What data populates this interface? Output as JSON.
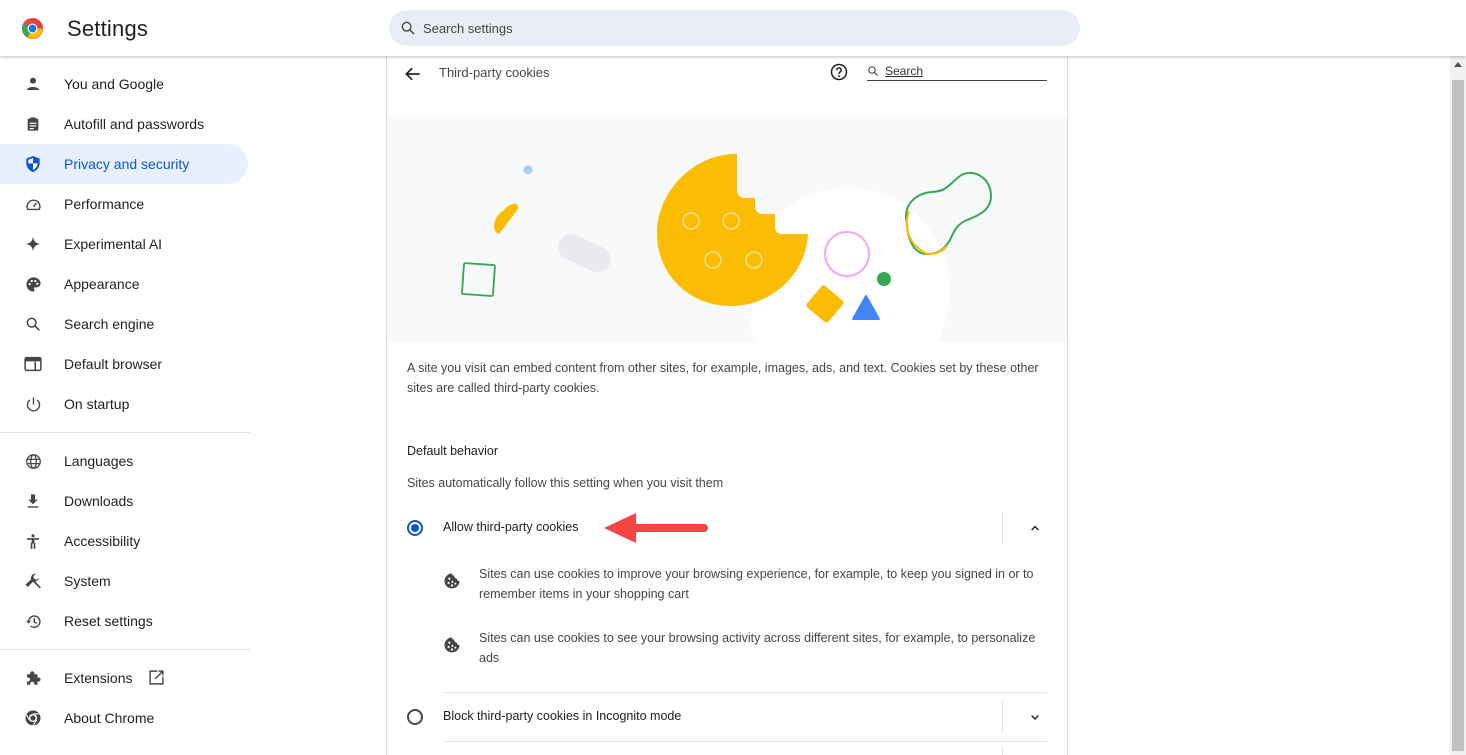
{
  "app": {
    "title": "Settings",
    "search_placeholder": "Search settings"
  },
  "sidebar": {
    "items": [
      {
        "label": "You and Google",
        "icon": "person-icon"
      },
      {
        "label": "Autofill and passwords",
        "icon": "clipboard-icon"
      },
      {
        "label": "Privacy and security",
        "icon": "shield-icon",
        "active": true
      },
      {
        "label": "Performance",
        "icon": "speedometer-icon"
      },
      {
        "label": "Experimental AI",
        "icon": "sparkle-icon"
      },
      {
        "label": "Appearance",
        "icon": "palette-icon"
      },
      {
        "label": "Search engine",
        "icon": "search-icon"
      },
      {
        "label": "Default browser",
        "icon": "browser-window-icon"
      },
      {
        "label": "On startup",
        "icon": "power-icon"
      },
      {
        "label": "Languages",
        "icon": "globe-icon"
      },
      {
        "label": "Downloads",
        "icon": "download-icon"
      },
      {
        "label": "Accessibility",
        "icon": "accessibility-icon"
      },
      {
        "label": "System",
        "icon": "wrench-icon"
      },
      {
        "label": "Reset settings",
        "icon": "history-icon"
      },
      {
        "label": "Extensions",
        "icon": "puzzle-icon"
      },
      {
        "label": "About Chrome",
        "icon": "chrome-icon"
      }
    ]
  },
  "page": {
    "title": "Third-party cookies",
    "search_placeholder": "Search",
    "description": "A site you visit can embed content from other sites, for example, images, ads, and text. Cookies set by these other sites are called third-party cookies.",
    "section_heading": "Default behavior",
    "section_subtitle": "Sites automatically follow this setting when you visit them",
    "options": [
      {
        "label": "Allow third-party cookies",
        "selected": true,
        "expanded": true,
        "details": [
          "Sites can use cookies to improve your browsing experience, for example, to keep you signed in or to remember items in your shopping cart",
          "Sites can use cookies to see your browsing activity across different sites, for example, to personalize ads"
        ]
      },
      {
        "label": "Block third-party cookies in Incognito mode",
        "selected": false,
        "expanded": false
      }
    ]
  },
  "colors": {
    "accent": "#0b57d0",
    "active_bg": "#e8f0fe",
    "annotation_arrow": "#f44444"
  }
}
